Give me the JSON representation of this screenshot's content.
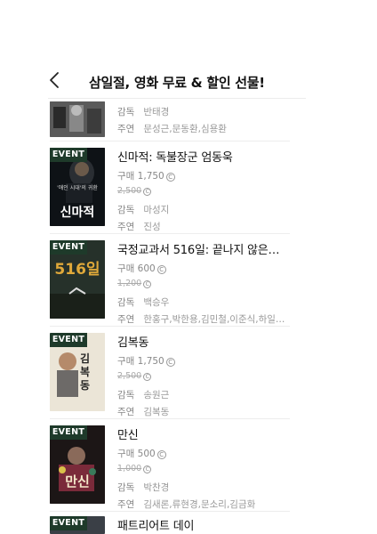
{
  "header": {
    "title": "삼일절, 영화 무료 & 할인 선물!"
  },
  "labels": {
    "director": "감독",
    "cast": "주연",
    "event": "EVENT",
    "purchase": "구매",
    "coin": "C"
  },
  "items": [
    {
      "title": "",
      "director": "반태경",
      "cast": "문성근,문동환,심용환"
    },
    {
      "title": "신마적: 독불장군 엄동욱",
      "price": "1,750",
      "original": "2,500",
      "director": "마성지",
      "cast": "진성",
      "poster_text": "신마적",
      "poster_sub": "'애인 시대'의 귀환"
    },
    {
      "title": "국정교과서 516일: 끝나지 않은…",
      "price": "600",
      "original": "1,200",
      "director": "백승우",
      "cast": "한홍구,박한용,김민철,이준식,하일…",
      "poster_text": "516일"
    },
    {
      "title": "김복동",
      "price": "1,750",
      "original": "2,500",
      "director": "송원근",
      "cast": "김복동",
      "poster_text": "김복동"
    },
    {
      "title": "만신",
      "price": "500",
      "original": "1,000",
      "director": "박찬경",
      "cast": "김새론,류현경,문소리,김금화",
      "poster_text": "만신"
    },
    {
      "title": "패트리어트 데이"
    }
  ]
}
